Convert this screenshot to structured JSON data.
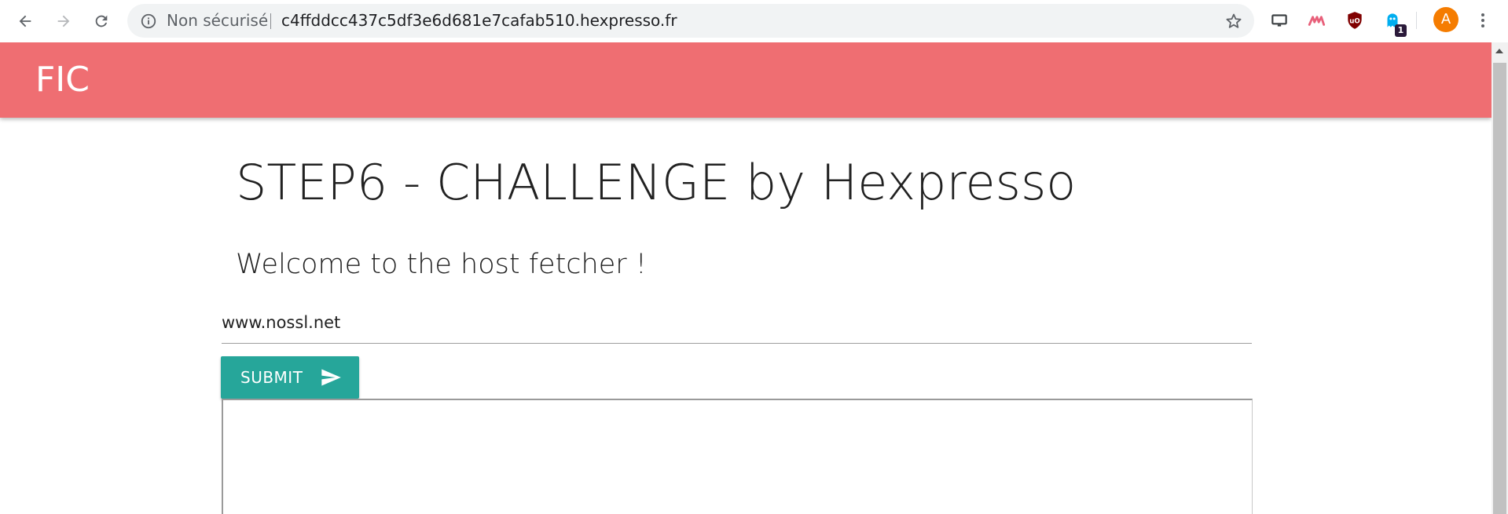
{
  "browser": {
    "security_label": "Non sécurisé",
    "url": "c4ffddcc437c5df3e6d681e7cafab510.hexpresso.fr",
    "extension_badge": "1",
    "avatar_letter": "A",
    "icons": [
      "back-icon",
      "forward-icon",
      "reload-icon",
      "info-icon",
      "star-icon",
      "cast-icon",
      "wave-extension-icon",
      "ublock-icon",
      "ghostery-icon",
      "menu-icon"
    ]
  },
  "app": {
    "brand": "FIC",
    "header_color": "#ef6e72"
  },
  "main": {
    "title": "STEP6 - CHALLENGE by Hexpresso",
    "welcome": "Welcome to the host fetcher !",
    "host_input_value": "www.nossl.net",
    "submit_label": "SUBMIT",
    "submit_color": "#26a69a",
    "result_text": ""
  }
}
